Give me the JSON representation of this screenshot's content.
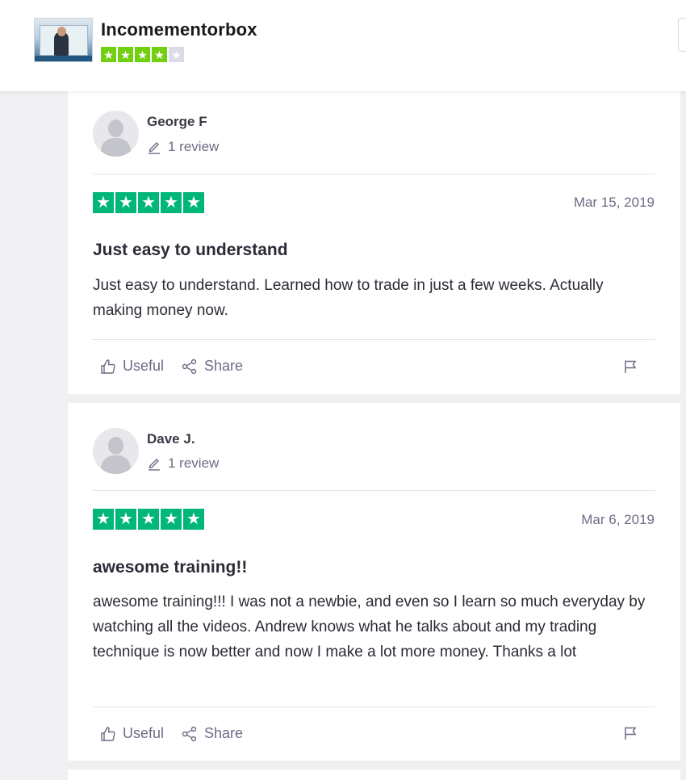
{
  "header": {
    "company_name": "Incomementorbox",
    "rating_stars_filled": 4,
    "rating_stars_total": 5,
    "star_color": "#73cf11",
    "star_off_color": "#dcdce6"
  },
  "reviews": [
    {
      "author": "George F",
      "review_count": "1 review",
      "stars": 5,
      "date": "Mar 15, 2019",
      "title": "Just easy to understand",
      "body": "Just easy to understand. Learned how to trade in just a few weeks. Actually making money now.",
      "useful_label": "Useful",
      "share_label": "Share"
    },
    {
      "author": "Dave J.",
      "review_count": "1 review",
      "stars": 5,
      "date": "Mar 6, 2019",
      "title": "awesome training!!",
      "body": "awesome training!!! I was not a newbie, and even so I learn so much everyday by watching all the videos. Andrew knows what he talks about and my trading technique is now better and now I make a lot more money. Thanks a lot",
      "useful_label": "Useful",
      "share_label": "Share"
    }
  ],
  "colors": {
    "review_star": "#00b67a",
    "muted_text": "#6c6c85"
  },
  "icons": {
    "pencil": "pencil-icon",
    "thumbs_up": "thumbs-up-icon",
    "share": "share-icon",
    "flag": "flag-icon",
    "star": "star-icon"
  }
}
